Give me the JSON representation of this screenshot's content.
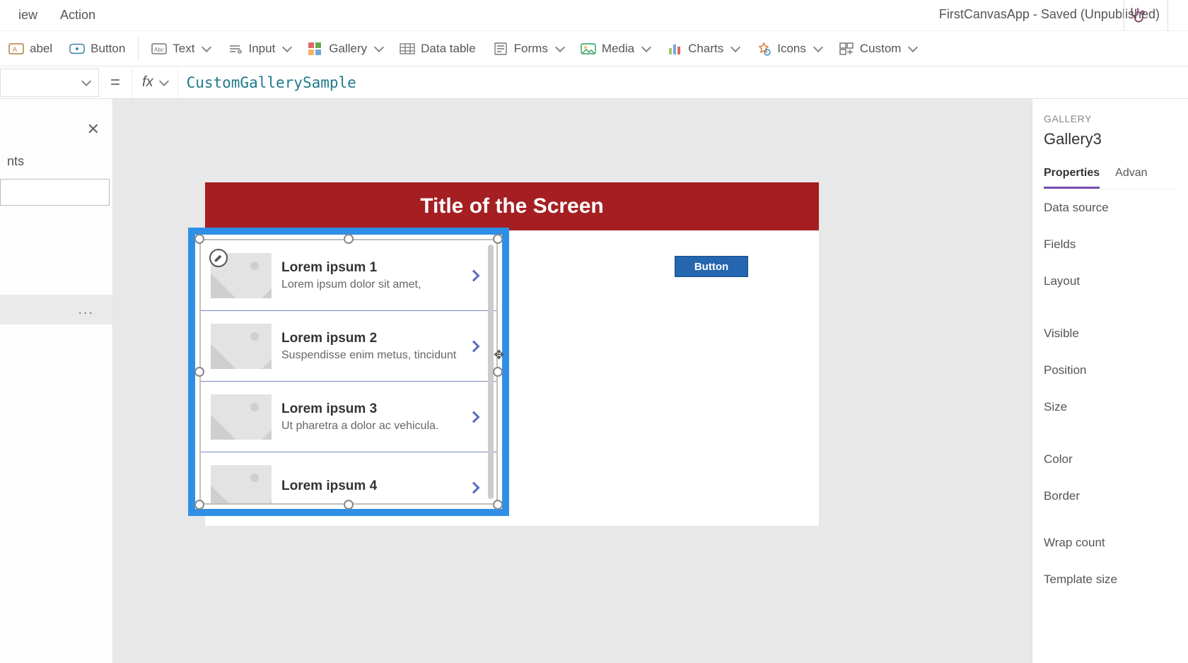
{
  "app_title": "FirstCanvasApp - Saved (Unpublished)",
  "menu": {
    "view": "iew",
    "action": "Action"
  },
  "ribbon": {
    "label": "abel",
    "button": "Button",
    "text": "Text",
    "input": "Input",
    "gallery": "Gallery",
    "datatable": "Data table",
    "forms": "Forms",
    "media": "Media",
    "charts": "Charts",
    "icons": "Icons",
    "custom": "Custom"
  },
  "formula": {
    "value": "CustomGallerySample",
    "fx": "fx"
  },
  "tree": {
    "title": "nts",
    "ellipsis": "..."
  },
  "screen": {
    "title": "Title of the Screen",
    "button_label": "Button"
  },
  "gallery_items": [
    {
      "title": "Lorem ipsum 1",
      "sub": "Lorem ipsum dolor sit amet,"
    },
    {
      "title": "Lorem ipsum 2",
      "sub": "Suspendisse enim metus, tincidunt"
    },
    {
      "title": "Lorem ipsum 3",
      "sub": "Ut pharetra a dolor ac vehicula."
    },
    {
      "title": "Lorem ipsum 4",
      "sub": ""
    }
  ],
  "props": {
    "category": "GALLERY",
    "name": "Gallery3",
    "tab_properties": "Properties",
    "tab_advanced": "Advan",
    "data_source": "Data source",
    "fields": "Fields",
    "layout": "Layout",
    "visible": "Visible",
    "position": "Position",
    "size": "Size",
    "color": "Color",
    "border": "Border",
    "wrap_count": "Wrap count",
    "template_size": "Template size"
  }
}
